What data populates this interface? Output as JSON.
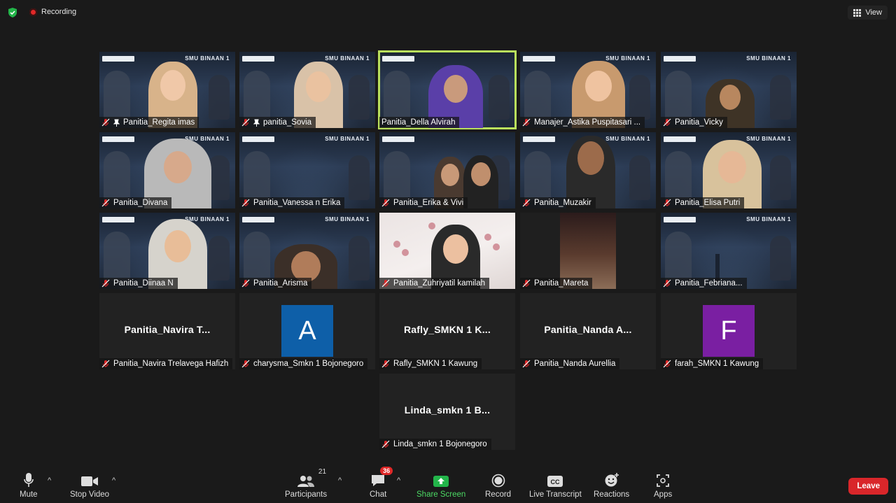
{
  "top": {
    "recording_label": "Recording",
    "view_label": "View"
  },
  "tiles": [
    {
      "name": "Panitia_Regita imas",
      "pinned": true
    },
    {
      "name": "panitia_Sovia",
      "pinned": true
    },
    {
      "name": "Panitia_Della Alvirah",
      "active": true
    },
    {
      "name": "Manajer_Astika Puspitasari ..."
    },
    {
      "name": "Panitia_Vicky"
    },
    {
      "name": "Panitia_Divana"
    },
    {
      "name": "Panitia_Vanessa n Erika"
    },
    {
      "name": "Panitia_Erika & Vivi"
    },
    {
      "name": "Panitia_Muzakir"
    },
    {
      "name": "Panitia_Elisa Putri"
    },
    {
      "name": "Panitia_Diinaa N"
    },
    {
      "name": "Panitia_Arisma"
    },
    {
      "name": "Panitia_Zuhriyatil kamilah"
    },
    {
      "name": "Panitia_Mareta"
    },
    {
      "name": "Panitia_Febriana..."
    },
    {
      "name": "Panitia_Navira Trelavega Hafizh",
      "center": "Panitia_Navira  T..."
    },
    {
      "name": "charysma_Smkn 1 Bojonegoro",
      "avatar": "A",
      "avatar_color": "#0e5fa8"
    },
    {
      "name": "Rafly_SMKN 1 Kawung",
      "center": "Rafly_SMKN  1  K..."
    },
    {
      "name": "Panitia_Nanda Aurellia",
      "center": "Panitia_Nanda  A..."
    },
    {
      "name": "farah_SMKN 1 Kawung",
      "avatar": "F",
      "avatar_color": "#7a1fa2"
    },
    {
      "name": "Linda_smkn 1 Bojonegoro",
      "center": "Linda_smkn  1  B..."
    }
  ],
  "background_text": "SMU BINAAN 1",
  "toolbar": {
    "mute": "Mute",
    "stop_video": "Stop Video",
    "participants": "Participants",
    "participants_count": "21",
    "chat": "Chat",
    "chat_badge": "36",
    "share_screen": "Share Screen",
    "record": "Record",
    "live_transcript": "Live Transcript",
    "reactions": "Reactions",
    "apps": "Apps",
    "leave": "Leave"
  },
  "colors": {
    "active_speaker": "#b9e05c",
    "share_green": "#4cd964",
    "leave_red": "#d9262a",
    "muted_red": "#e02828"
  }
}
